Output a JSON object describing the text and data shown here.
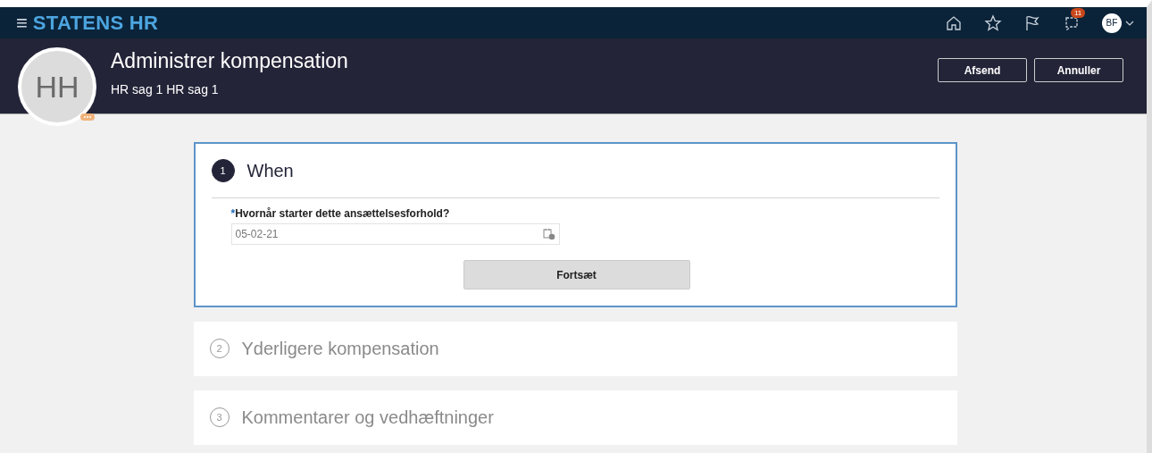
{
  "top_bar": {
    "menu_glyph": "≡",
    "brand": "STATENS HR",
    "notifications_count": "11",
    "user_initials": "BF"
  },
  "header": {
    "avatar_initials": "HH",
    "title": "Administrer kompensation",
    "subtitle": "HR sag 1 HR sag 1",
    "buttons": [
      "Afsend",
      "Annuller"
    ]
  },
  "steps": [
    {
      "number": "1",
      "title": "When",
      "selected": true,
      "field": {
        "label": "Hvornår starter dette ansættelsesforhold?",
        "required_mark": "*",
        "value": "05-02-21"
      },
      "button": "Fortsæt"
    },
    {
      "number": "2",
      "title": "Yderligere kompensation",
      "selected": false
    },
    {
      "number": "3",
      "title": "Kommentarer og vedhæftninger",
      "selected": false
    }
  ]
}
